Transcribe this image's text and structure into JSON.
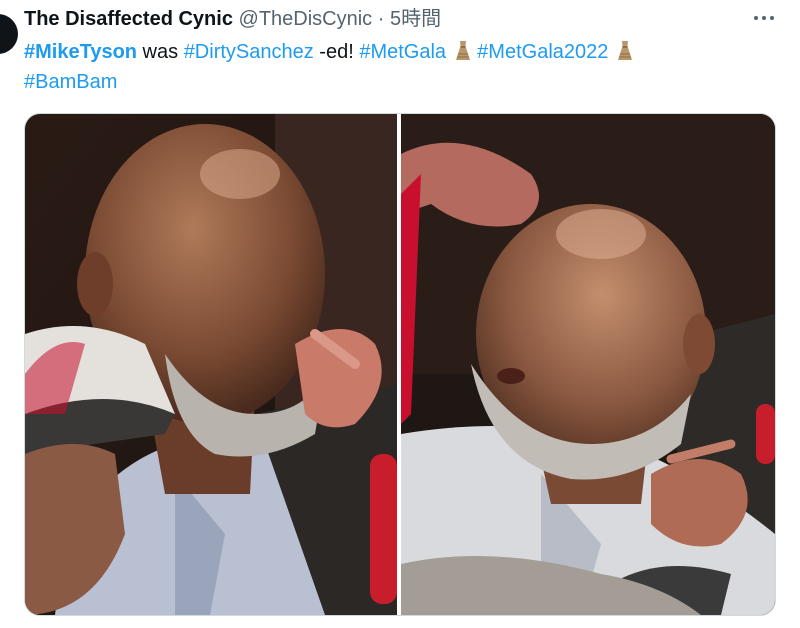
{
  "tweet": {
    "author": {
      "display_name": "The Disaffected Cynic",
      "handle": "@TheDisCynic",
      "separator": "·",
      "time": "5時間"
    },
    "text": {
      "tag_mike_tyson": "#MikeTyson",
      "word_was": " was ",
      "tag_dirty_sanchez": "#DirtySanchez",
      "word_ed": " -ed! ",
      "tag_met_gala": "#MetGala",
      "tag_met_gala_2022": "#MetGala2022",
      "tag_bam_bam": "#BamBam"
    },
    "emoji": "dress-emoji",
    "link_color": "#1d9bf0",
    "text_color": "#0f1419",
    "muted_color": "#536471"
  },
  "media": {
    "photos": [
      {
        "icon": "photo-left"
      },
      {
        "icon": "photo-right"
      }
    ]
  }
}
